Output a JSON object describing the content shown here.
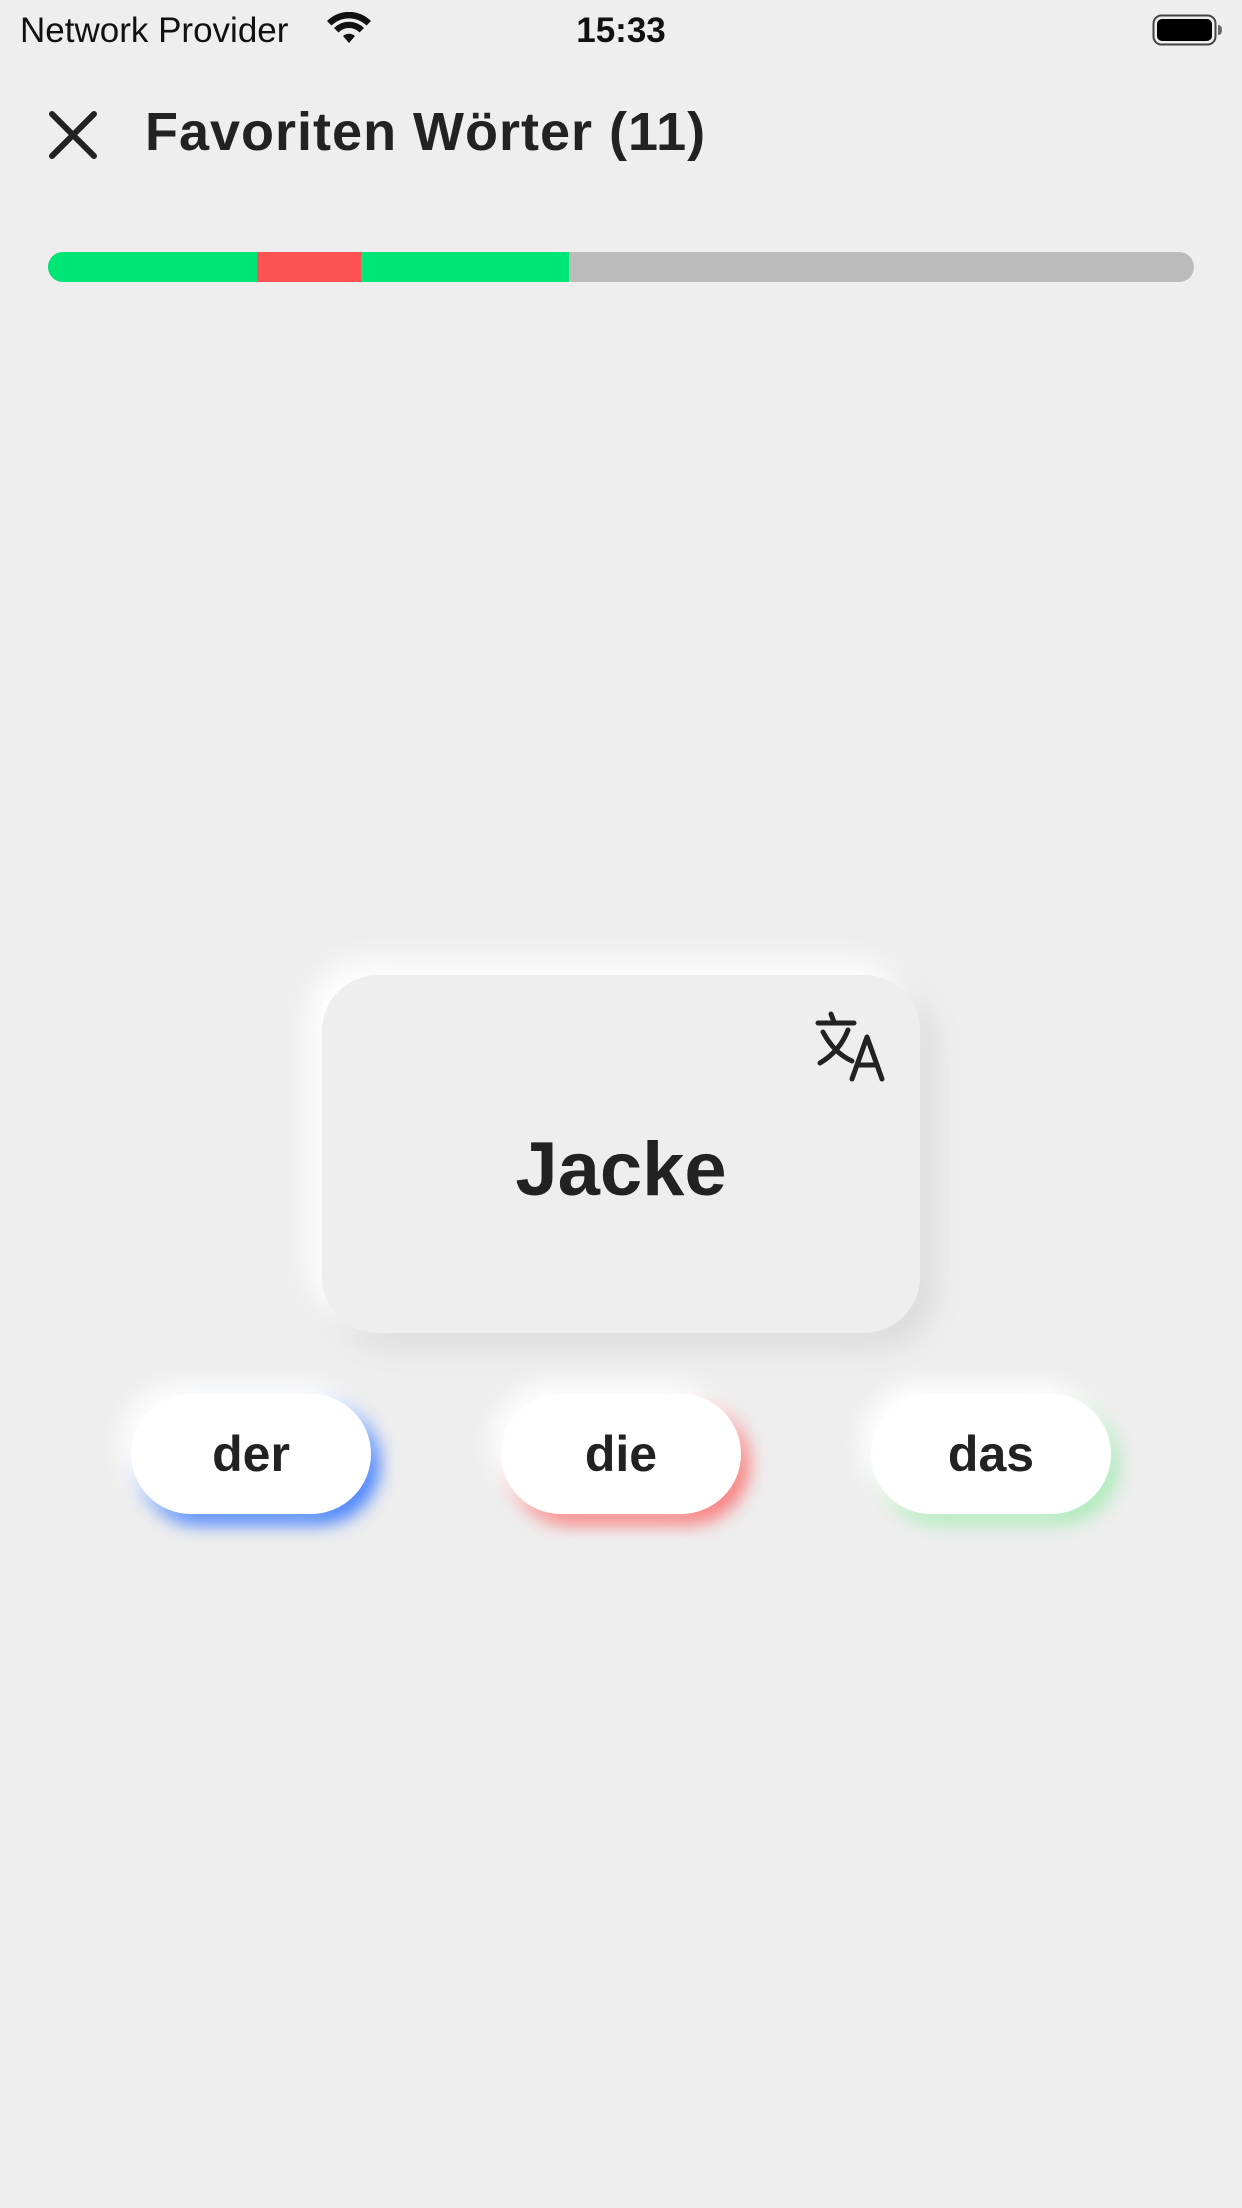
{
  "status_bar": {
    "carrier": "Network Provider",
    "time": "15:33",
    "wifi_icon": "wifi-icon",
    "battery_icon": "battery-icon"
  },
  "header": {
    "close_icon": "close-icon",
    "title": "Favoriten Wörter (11)"
  },
  "progress": {
    "segments": [
      {
        "status": "correct",
        "fraction": 0.182,
        "color": "#00e676"
      },
      {
        "status": "wrong",
        "fraction": 0.091,
        "color": "#ff5252"
      },
      {
        "status": "correct",
        "fraction": 0.182,
        "color": "#00e676"
      }
    ],
    "track_color": "#bbbbbb"
  },
  "card": {
    "word": "Jacke",
    "translate_icon": "translate-icon"
  },
  "articles": {
    "der_label": "der",
    "die_label": "die",
    "das_label": "das",
    "der_color": "#2a6eff",
    "die_color": "#ff5252",
    "das_color": "#5ae678"
  }
}
